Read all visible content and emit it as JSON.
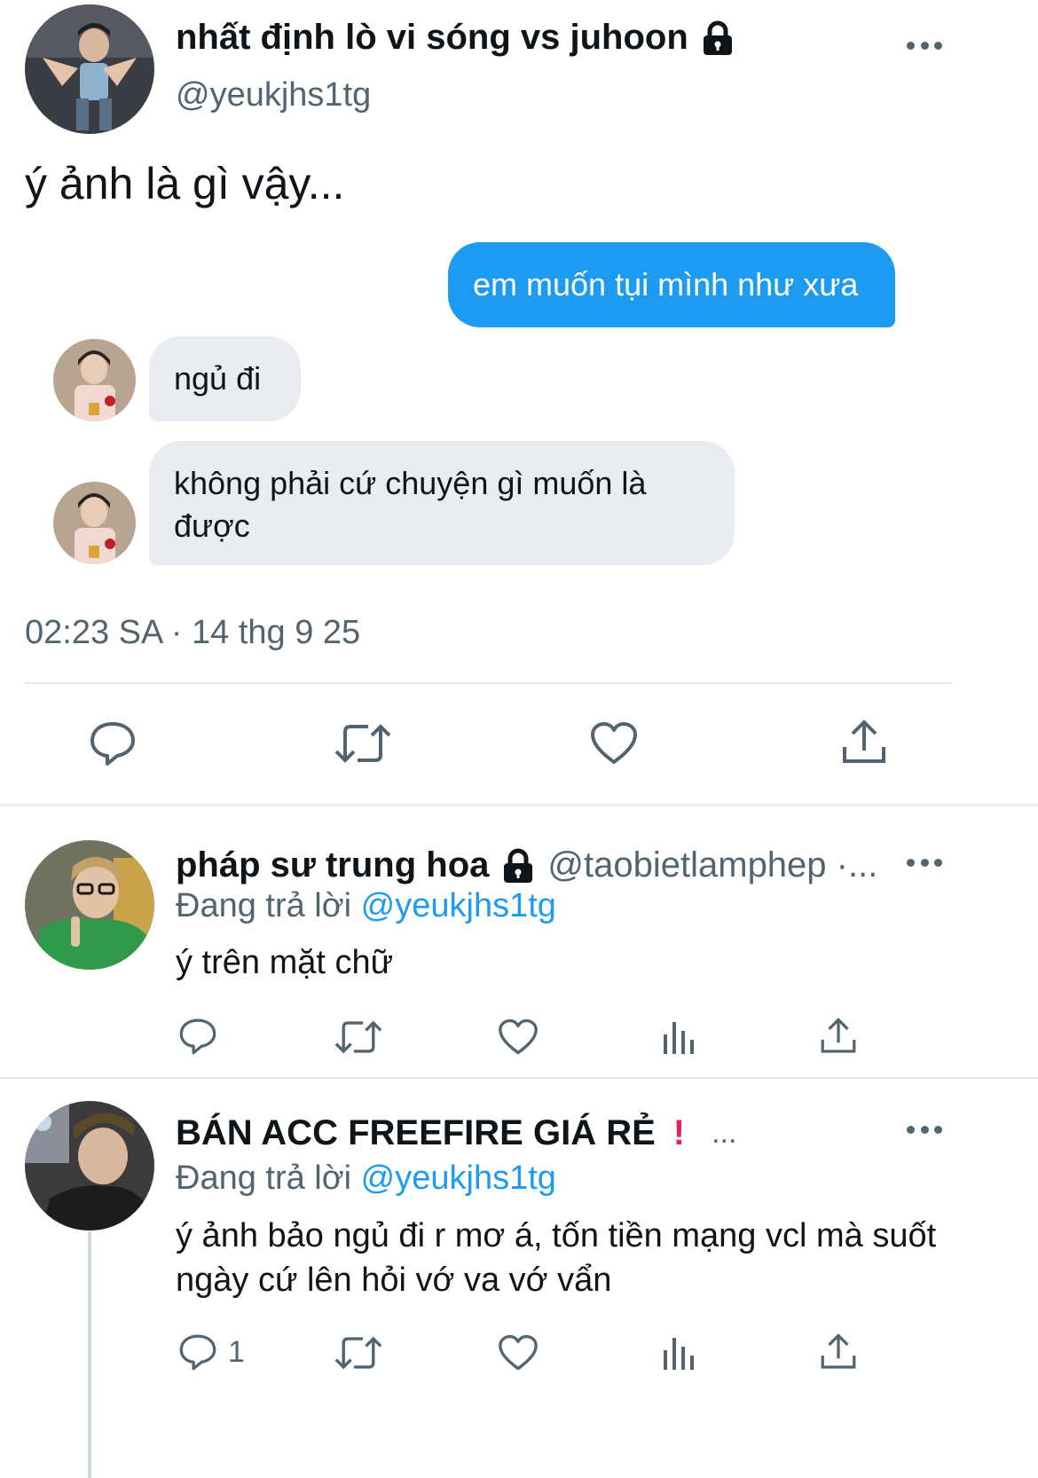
{
  "main_tweet": {
    "author_name": "nhất định lò vi sóng vs juhoon",
    "author_handle": "@yeukjhs1tg",
    "text": "ý ảnh là gì vậy...",
    "messages": [
      {
        "from": "me",
        "text": "em muốn tụi mình như xưa"
      },
      {
        "from": "them",
        "text": "ngủ đi"
      },
      {
        "from": "them",
        "text": "không phải cứ chuyện gì muốn là được"
      }
    ],
    "timestamp": "02:23 SA · 14 thg 9 25"
  },
  "replies": [
    {
      "author_name": "pháp sư trung hoa",
      "author_handle": "@taobietlamphep ·...",
      "replying_prefix": "Đang trả lời",
      "replying_to": "@yeukjhs1tg",
      "text": "ý trên mặt chữ"
    },
    {
      "author_name": "BÁN ACC FREEFIRE GIÁ RẺ",
      "emoji_mark": "!",
      "author_suffix": "...",
      "replying_prefix": "Đang trả lời",
      "replying_to": "@yeukjhs1tg",
      "text": "ý ảnh bảo ngủ đi r mơ á, tốn tiền mạng vcl mà suốt ngày cứ lên hỏi vớ va vớ vẩn",
      "reply_count": "1"
    }
  ],
  "colors": {
    "accent": "#1d9bf0",
    "muted": "#536471",
    "bubble_gray": "#e9edf1",
    "warning": "#e0245e"
  },
  "icons": [
    "lock-icon",
    "more-icon",
    "reply-icon",
    "retweet-icon",
    "like-icon",
    "share-icon",
    "views-icon"
  ]
}
